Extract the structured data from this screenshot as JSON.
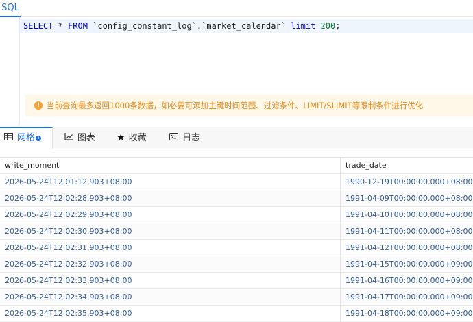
{
  "editor": {
    "tab_label": "SQL",
    "sql": {
      "select": "SELECT",
      "star": " * ",
      "from": "FROM",
      "table": " `config_constant_log`.`market_calendar` ",
      "limit": "limit",
      "value": " 200",
      "end": ";"
    }
  },
  "notice": {
    "icon": "warning-icon",
    "text": "当前查询最多返回1000条数据，如必要可添加主键时间范围、过滤条件、LIMIT/SLIMIT等限制条件进行优化"
  },
  "result_tabs": [
    {
      "label": "网格",
      "icon": "grid-icon"
    },
    {
      "label": "图表",
      "icon": "chart-icon"
    },
    {
      "label": "收藏",
      "icon": "star-icon"
    },
    {
      "label": "日志",
      "icon": "terminal-icon"
    }
  ],
  "grid": {
    "columns": [
      "write_moment",
      "trade_date"
    ],
    "rows": [
      [
        "2026-05-24T12:01:12.903+08:00",
        "1990-12-19T00:00:00.000+08:00"
      ],
      [
        "2026-05-24T12:02:28.903+08:00",
        "1991-04-09T00:00:00.000+08:00"
      ],
      [
        "2026-05-24T12:02:29.903+08:00",
        "1991-04-10T00:00:00.000+08:00"
      ],
      [
        "2026-05-24T12:02:30.903+08:00",
        "1991-04-11T00:00:00.000+08:00"
      ],
      [
        "2026-05-24T12:02:31.903+08:00",
        "1991-04-12T00:00:00.000+08:00"
      ],
      [
        "2026-05-24T12:02:32.903+08:00",
        "1991-04-15T00:00:00.000+09:00"
      ],
      [
        "2026-05-24T12:02:33.903+08:00",
        "1991-04-16T00:00:00.000+09:00"
      ],
      [
        "2026-05-24T12:02:34.903+08:00",
        "1991-04-17T00:00:00.000+09:00"
      ],
      [
        "2026-05-24T12:02:35.903+08:00",
        "1991-04-18T00:00:00.000+09:00"
      ]
    ]
  },
  "colors": {
    "accent": "#1e6fd9",
    "warning_text": "#e08a1a",
    "warning_bg": "#fff7e8",
    "cell_text": "#2c5aa0"
  }
}
